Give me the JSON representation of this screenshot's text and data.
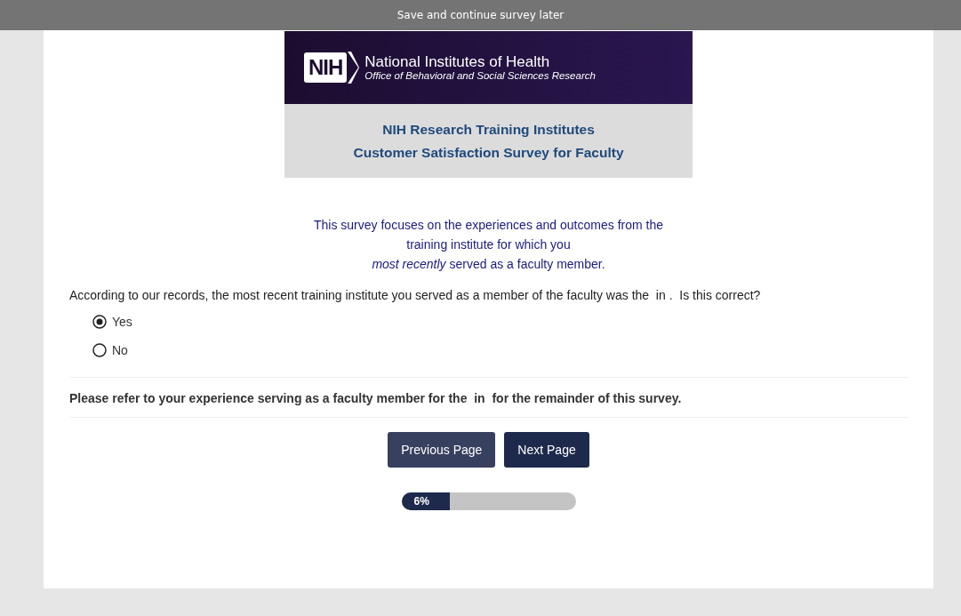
{
  "top_bar": {
    "link": "Save and continue survey later"
  },
  "banner": {
    "logo_mark": "NIH",
    "org_name": "National Institutes of Health",
    "office": "Office of Behavioral and Social Sciences Research",
    "title_lines": [
      "NIH Research Training Institutes",
      "Customer Satisfaction Survey for Faculty"
    ]
  },
  "intro_lines": [
    "This survey focuses on the experiences and outcomes from the",
    "training institute for which you",
    "*most recently* served as a faculty member."
  ],
  "question": {
    "text": "According to our records, the most recent training institute you served as a member of the faculty was the  in .  Is this correct?",
    "options": [
      {
        "label": "Yes",
        "selected": true
      },
      {
        "label": "No",
        "selected": false
      }
    ]
  },
  "note": "Please refer to your experience serving as a faculty member for the  in  for the remainder of this survey.",
  "buttons": [
    "Previous Page",
    "Next Page"
  ],
  "progress": {
    "label": "6%",
    "level": 0.28
  }
}
